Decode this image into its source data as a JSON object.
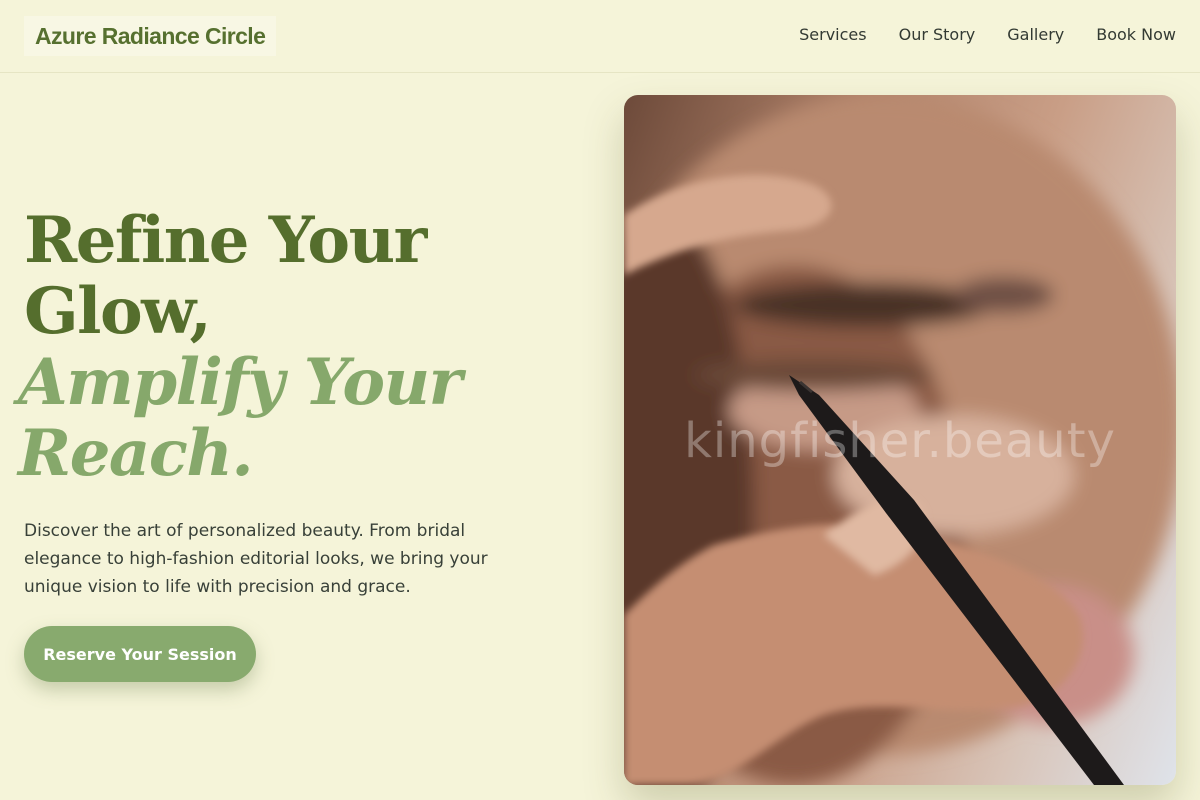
{
  "brand": {
    "name": "Azure Radiance Circle"
  },
  "nav": {
    "items": [
      {
        "label": "Services"
      },
      {
        "label": "Our Story"
      },
      {
        "label": "Gallery"
      },
      {
        "label": "Book Now"
      }
    ]
  },
  "hero": {
    "title_line1": "Refine Your",
    "title_line2": "Glow,",
    "title_accent_line1": "Amplify Your",
    "title_accent_line2": "Reach.",
    "description": "Discover the art of personalized beauty. From bridal elegance to high-fashion editorial looks, we bring your unique vision to life with precision and grace.",
    "cta_label": "Reserve Your Session"
  },
  "image": {
    "description": "close-up of makeup artist applying eyeliner",
    "watermark": "kingfisher.beauty"
  },
  "colors": {
    "background": "#f5f4d9",
    "brand_green": "#556e2d",
    "accent_green": "#86a86b",
    "button": "#88aa6e"
  }
}
